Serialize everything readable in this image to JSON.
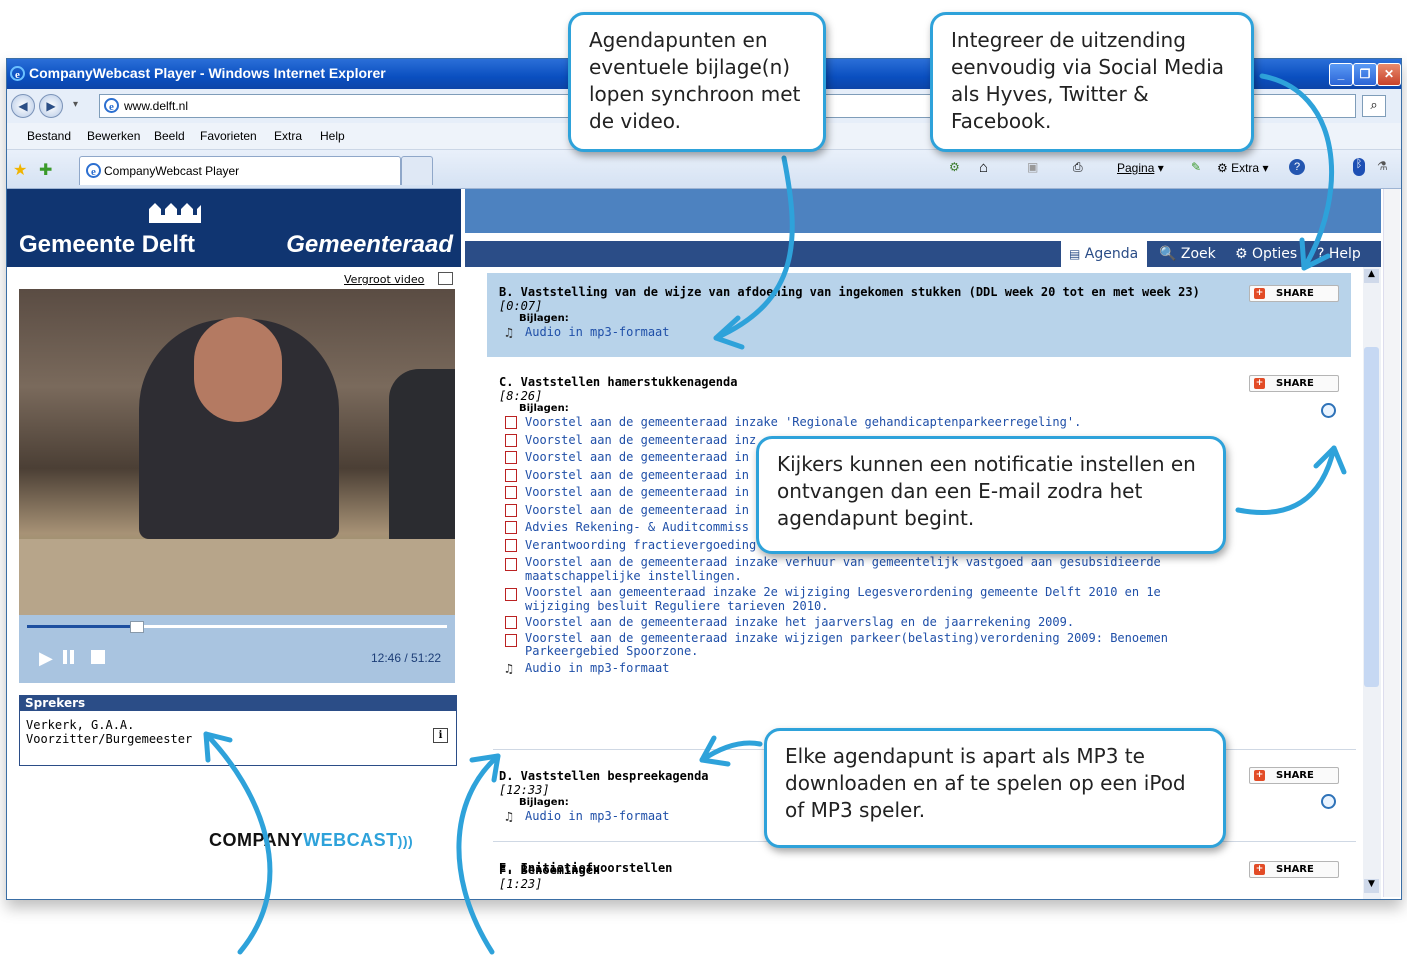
{
  "browser": {
    "title": "CompanyWebcast Player - Windows Internet Explorer",
    "address": "www.delft.nl",
    "menu": [
      "Bestand",
      "Bewerken",
      "Beeld",
      "Favorieten",
      "Extra",
      "Help"
    ],
    "tab_label": "CompanyWebcast Player",
    "toolbar_right": {
      "pagina": "Pagina",
      "extra": "Extra"
    }
  },
  "player": {
    "brand_left": "Gemeente Delft",
    "brand_right": "Gemeenteraad",
    "vergroot": "Vergroot video",
    "time": "12:46 / 51:22",
    "progress": 0.26,
    "sprekers_title": "Sprekers",
    "speaker_name": "Verkerk, G.A.A.",
    "speaker_role": "Voorzitter/Burgemeester",
    "footer_logo_a": "COMPANY",
    "footer_logo_b": "WEBCAST"
  },
  "nav": {
    "agenda": "Agenda",
    "zoek": "Zoek",
    "opties": "Opties",
    "help": "Help"
  },
  "agenda": {
    "share": "SHARE",
    "bijlagen": "Bijlagen:",
    "audio": "Audio in mp3-formaat",
    "items": [
      {
        "title": "B. Vaststelling van de wijze van afdoening van ingekomen stukken (DDL week 20 tot en met week 23)",
        "time": "[0:07]"
      },
      {
        "title": "C. Vaststellen hamerstukkenagenda",
        "time": "[8:26]"
      },
      {
        "title": "D. Vaststellen bespreekagenda",
        "time": "[12:33]"
      },
      {
        "title": "E. Initiatiefvoorstellen",
        "time": ""
      },
      {
        "title": "F. Benoemingen",
        "time": "[1:23]"
      }
    ],
    "c_links": [
      "Voorstel aan de gemeenteraad inzake 'Regionale gehandicaptenparkeerregeling'.",
      "Voorstel aan de gemeenteraad inz",
      "Voorstel aan de gemeenteraad in",
      "Voorstel aan de gemeenteraad in",
      "Voorstel aan de gemeenteraad in",
      "Voorstel aan de gemeenteraad in",
      "Advies Rekening- & Auditcommiss",
      "Verantwoording fractievergoeding",
      "Voorstel aan de gemeenteraad inzake verhuur van gemeentelijk vastgoed aan gesubsidieerde maatschappelijke instellingen.",
      "Voorstel aan gemeenteraad inzake 2e wijziging Legesverordening gemeente Delft 2010 en 1e wijziging besluit Reguliere tarieven 2010.",
      "Voorstel aan de gemeenteraad inzake het jaarverslag en de jaarrekening 2009.",
      "Voorstel aan de gemeenteraad inzake wijzigen parkeer(belasting)verordening 2009: Benoemen Parkeergebied Spoorzone."
    ]
  },
  "callouts": {
    "agendapunten": "Agendapunten en eventuele bijlage(n) lopen synchroon met de video.",
    "social": "Integreer de uitzending eenvoudig via Social Media als Hyves, Twitter & Facebook.",
    "notificatie": "Kijkers kunnen een notificatie instellen en ontvangen dan een E-mail zodra het agendapunt begint.",
    "mp3": "Elke agendapunt is apart als MP3 te downloaden en af te spelen op een iPod of MP3 speler."
  },
  "colors": {
    "accent": "#2ea2da",
    "banner": "#103571",
    "link": "#1f4fa8",
    "highlight": "#b8d3ea"
  }
}
